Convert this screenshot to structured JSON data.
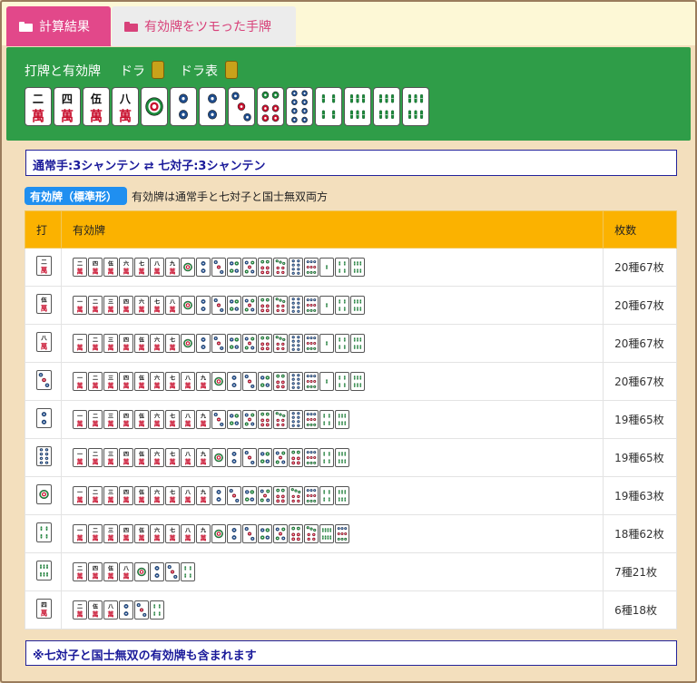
{
  "tabs": [
    {
      "label": "計算結果",
      "active": true,
      "icon": "folder-open-icon"
    },
    {
      "label": "有効牌をツモった手牌",
      "active": false,
      "icon": "folder-icon"
    }
  ],
  "hand_section": {
    "title": "打牌と有効牌",
    "dora_label": "ドラ",
    "dora_indicator_label": "ドラ表",
    "tiles": [
      "2m",
      "4m",
      "5m",
      "8m",
      "1p",
      "2p",
      "2p",
      "3p",
      "6p",
      "8p",
      "4s",
      "6s",
      "6s",
      "6s"
    ]
  },
  "shanten": {
    "normal": "通常手:3シャンテン",
    "arrow": "⇄",
    "chiitoi": "七対子:3シャンテン"
  },
  "badge": {
    "label": "有効牌（標準形）",
    "note": "有効牌は通常手と七対子と国士無双両方"
  },
  "table": {
    "headers": [
      "打",
      "有効牌",
      "枚数"
    ],
    "rows": [
      {
        "discard": "2m",
        "tiles": [
          "2m",
          "4m",
          "5m",
          "6m",
          "7m",
          "8m",
          "9m",
          "1p",
          "2p",
          "3p",
          "4p",
          "5p",
          "6p",
          "7p",
          "8p",
          "9p",
          "1s",
          "4s",
          "6s"
        ],
        "count": "20種67枚"
      },
      {
        "discard": "5m",
        "tiles": [
          "1m",
          "2m",
          "3m",
          "4m",
          "6m",
          "7m",
          "8m",
          "1p",
          "2p",
          "3p",
          "4p",
          "5p",
          "6p",
          "7p",
          "8p",
          "9p",
          "1s",
          "4s",
          "6s"
        ],
        "count": "20種67枚"
      },
      {
        "discard": "8m",
        "tiles": [
          "1m",
          "2m",
          "3m",
          "4m",
          "5m",
          "6m",
          "7m",
          "1p",
          "2p",
          "3p",
          "4p",
          "5p",
          "6p",
          "7p",
          "8p",
          "9p",
          "1s",
          "4s",
          "6s"
        ],
        "count": "20種67枚"
      },
      {
        "discard": "3p",
        "tiles": [
          "1m",
          "2m",
          "3m",
          "4m",
          "5m",
          "6m",
          "7m",
          "8m",
          "9m",
          "1p",
          "2p",
          "3p",
          "4p",
          "6p",
          "8p",
          "9p",
          "1s",
          "4s",
          "6s"
        ],
        "count": "20種67枚"
      },
      {
        "discard": "2p",
        "tiles": [
          "1m",
          "2m",
          "3m",
          "4m",
          "5m",
          "6m",
          "7m",
          "8m",
          "9m",
          "3p",
          "4p",
          "5p",
          "6p",
          "7p",
          "8p",
          "9p",
          "4s",
          "6s"
        ],
        "count": "19種65枚"
      },
      {
        "discard": "8p",
        "tiles": [
          "1m",
          "2m",
          "3m",
          "4m",
          "5m",
          "6m",
          "7m",
          "8m",
          "9m",
          "1p",
          "2p",
          "3p",
          "4p",
          "5p",
          "6p",
          "9p",
          "4s",
          "6s"
        ],
        "count": "19種65枚"
      },
      {
        "discard": "1p",
        "tiles": [
          "1m",
          "2m",
          "3m",
          "4m",
          "5m",
          "6m",
          "7m",
          "8m",
          "9m",
          "2p",
          "3p",
          "4p",
          "5p",
          "6p",
          "7p",
          "9p",
          "4s",
          "6s"
        ],
        "count": "19種63枚"
      },
      {
        "discard": "4s",
        "tiles": [
          "1m",
          "2m",
          "3m",
          "4m",
          "5m",
          "6m",
          "7m",
          "8m",
          "9m",
          "1p",
          "2p",
          "3p",
          "4p",
          "5p",
          "6p",
          "7p",
          "8s",
          "9p"
        ],
        "count": "18種62枚"
      },
      {
        "discard": "6s",
        "tiles": [
          "2m",
          "4m",
          "5m",
          "8m",
          "1p",
          "2p",
          "3p",
          "4s"
        ],
        "count": "7種21枚"
      },
      {
        "discard": "4m",
        "tiles": [
          "2m",
          "5m",
          "8m",
          "2p",
          "3p",
          "4s"
        ],
        "count": "6種18枚"
      }
    ]
  },
  "footer_note": "※七対子と国士無双の有効牌も含まれます",
  "colors": {
    "tab_active": "#e2488a",
    "green_panel": "#2f9d48",
    "table_header": "#fbb200",
    "badge": "#1f8ff0",
    "note_text": "#1a1a9a",
    "background": "#f3dfbd"
  }
}
